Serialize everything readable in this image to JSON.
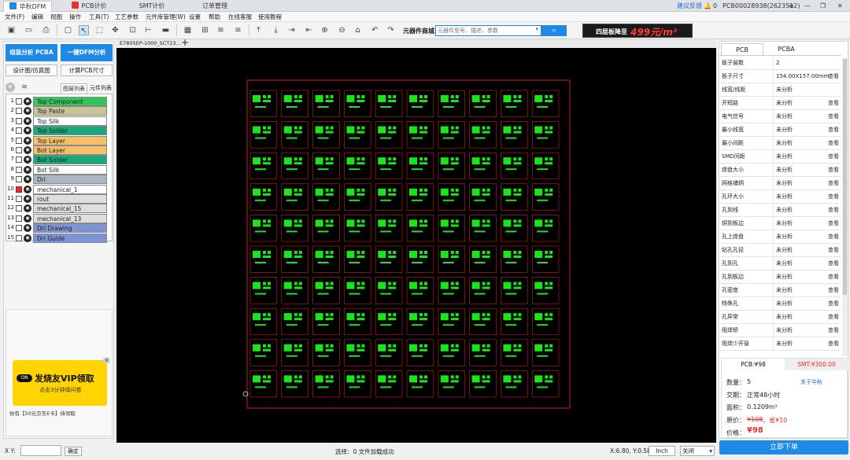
{
  "tabs": [
    {
      "label": "华秋DFM",
      "active": true
    },
    {
      "label": "PCB计价",
      "active": false
    },
    {
      "label": "SMT计价",
      "active": false
    },
    {
      "label": "订单管理",
      "active": false
    }
  ],
  "title_right": {
    "feedback": "建议反馈",
    "notif": "0",
    "account": "PCB00028938(2623512)"
  },
  "menu": [
    "文件(F)",
    "编辑",
    "视图",
    "操作",
    "工具(T)",
    "工艺参数",
    "元件库管理(W)",
    "设置",
    "帮助",
    "在线客服",
    "使用教程"
  ],
  "toolbar": {
    "mall_label": "元器件商城",
    "search_placeholder": "元器件型号、描述、参数",
    "banner_text": "四层板降至",
    "banner_price": "499元/m²"
  },
  "left": {
    "btn_analyze": "组装分析 PCBA",
    "btn_dfm": "一键DFM分析",
    "btn_design": "设计图/仿真图",
    "btn_size": "计算PCB尺寸",
    "tab_layers": "图层列表",
    "tab_parts": "元件列表",
    "layers": [
      {
        "n": "1",
        "name": "Top Component",
        "color": "#33c45a",
        "checked": false
      },
      {
        "n": "2",
        "name": "Top Paste",
        "color": "#c8c496",
        "checked": false
      },
      {
        "n": "3",
        "name": "Top Silk",
        "color": "#ffffff",
        "checked": false
      },
      {
        "n": "4",
        "name": "Top Solder",
        "color": "#17a97a",
        "checked": false
      },
      {
        "n": "5",
        "name": "Top Layer",
        "color": "#f5c06a",
        "checked": false
      },
      {
        "n": "6",
        "name": "Bot Layer",
        "color": "#f5c06a",
        "checked": false
      },
      {
        "n": "7",
        "name": "Bot Solder",
        "color": "#17a97a",
        "checked": false
      },
      {
        "n": "8",
        "name": "Bot Silk",
        "color": "#ffffff",
        "checked": false
      },
      {
        "n": "9",
        "name": "Drl",
        "color": "#a9b6c4",
        "checked": false
      },
      {
        "n": "10",
        "name": "mechanical_1",
        "color": "#ffffff",
        "checked": true
      },
      {
        "n": "11",
        "name": "rout",
        "color": "#dedede",
        "checked": false
      },
      {
        "n": "12",
        "name": "mechanical_15",
        "color": "#dedede",
        "checked": false
      },
      {
        "n": "13",
        "name": "mechanical_13",
        "color": "#dedede",
        "checked": false
      },
      {
        "n": "14",
        "name": "Drl Drawing",
        "color": "#7f93d8",
        "checked": false
      },
      {
        "n": "15",
        "name": "Drl Guide",
        "color": "#7f93d8",
        "checked": false
      }
    ],
    "ad_title": "发烧友VIP领取",
    "ad_sub": "点击3分钟填问卷",
    "ad_on": "ON",
    "ad_note": "你有【50元京东E卡】待领取"
  },
  "doc_tab": "E7805EP-1000_SCT23...",
  "right": {
    "tab_pcb": "PCB",
    "tab_pcba": "PCBA",
    "props": [
      {
        "k": "板子层数",
        "v": "2",
        "a": ""
      },
      {
        "k": "板子尺寸",
        "v": "154.00X157.00mm",
        "a": "查看"
      },
      {
        "k": "线宽/线距",
        "v": "未分析",
        "a": ""
      },
      {
        "k": "开短路",
        "v": "未分析",
        "a": "查看"
      },
      {
        "k": "电气信号",
        "v": "未分析",
        "a": "查看"
      },
      {
        "k": "最小线宽",
        "v": "未分析",
        "a": "查看"
      },
      {
        "k": "最小间距",
        "v": "未分析",
        "a": "查看"
      },
      {
        "k": "SMD间距",
        "v": "未分析",
        "a": "查看"
      },
      {
        "k": "焊盘大小",
        "v": "未分析",
        "a": "查看"
      },
      {
        "k": "网格铺铜",
        "v": "未分析",
        "a": "查看"
      },
      {
        "k": "孔环大小",
        "v": "未分析",
        "a": "查看"
      },
      {
        "k": "孔到线",
        "v": "未分析",
        "a": "查看"
      },
      {
        "k": "铜到板边",
        "v": "未分析",
        "a": "查看"
      },
      {
        "k": "孔上焊盘",
        "v": "未分析",
        "a": "查看"
      },
      {
        "k": "钻孔孔径",
        "v": "未分析",
        "a": "查看"
      },
      {
        "k": "孔到孔",
        "v": "未分析",
        "a": "查看"
      },
      {
        "k": "孔到板边",
        "v": "未分析",
        "a": "查看"
      },
      {
        "k": "孔密度",
        "v": "未分析",
        "a": "查看"
      },
      {
        "k": "特殊孔",
        "v": "未分析",
        "a": "查看"
      },
      {
        "k": "孔异常",
        "v": "未分析",
        "a": "查看"
      },
      {
        "k": "阻焊桥",
        "v": "未分析",
        "a": "查看"
      },
      {
        "k": "阻焊少开窗",
        "v": "未分析",
        "a": "查看"
      }
    ],
    "price_tab_pcb": "PCB:¥98",
    "price_tab_smt": "SMT:¥300.00",
    "qty_label": "数量：",
    "qty": "5",
    "about": "关于华秋",
    "delivery_label": "交期：",
    "delivery": "正常48小时",
    "area_label": "面积：",
    "area": "0.1209m²",
    "orig_label": "原价：",
    "orig": "¥108",
    "save": "，省¥10",
    "price_label": "价格：",
    "price": "¥98",
    "order_btn": "立即下单"
  },
  "status": {
    "xy_label": "X Y:",
    "ok_btn": "确定",
    "select_text": "选择：0  文件加载成功",
    "coords": "X:6.80, Y:0.58",
    "unit": "Inch",
    "dropdown": "关闭"
  },
  "colors": {
    "accent": "#1e8ae6",
    "price_red": "#e53030",
    "pcb_green": "#19e619",
    "outline": "#cc2020"
  }
}
